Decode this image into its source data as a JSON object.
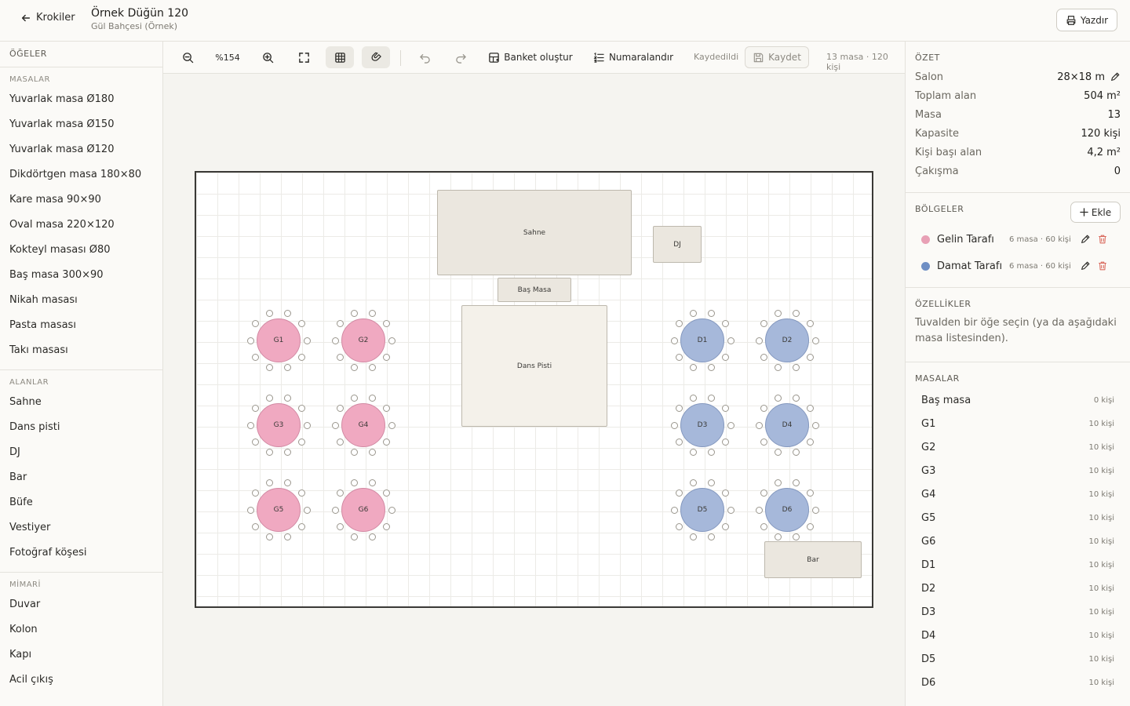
{
  "header": {
    "back_label": "Krokiler",
    "title": "Örnek Düğün 120",
    "subtitle": "Gül Bahçesi (Örnek)",
    "print_label": "Yazdır"
  },
  "sidebar": {
    "heading": "ÖĞELER",
    "sections": [
      {
        "title": "MASALAR",
        "items": [
          "Yuvarlak masa Ø180",
          "Yuvarlak masa Ø150",
          "Yuvarlak masa Ø120",
          "Dikdörtgen masa 180×80",
          "Kare masa 90×90",
          "Oval masa 220×120",
          "Kokteyl masası Ø80",
          "Baş masa 300×90",
          "Nikah masası",
          "Pasta masası",
          "Takı masası"
        ]
      },
      {
        "title": "ALANLAR",
        "items": [
          "Sahne",
          "Dans pisti",
          "DJ",
          "Bar",
          "Büfe",
          "Vestiyer",
          "Fotoğraf köşesi"
        ]
      },
      {
        "title": "MİMARİ",
        "items": [
          "Duvar",
          "Kolon",
          "Kapı",
          "Acil çıkış"
        ]
      }
    ]
  },
  "toolbar": {
    "zoom": "%154",
    "banquet_label": "Banket oluştur",
    "numbering_label": "Numaralandır",
    "saved_status": "Kaydedildi",
    "save_label": "Kaydet",
    "summary": "13 masa · 120 kişi"
  },
  "canvas": {
    "zones": {
      "stage": "Sahne",
      "dj": "DJ",
      "head_table": "Baş Masa",
      "dance": "Dans Pisti",
      "bar": "Bar"
    },
    "tables": [
      "G1",
      "G2",
      "G3",
      "G4",
      "G5",
      "G6",
      "D1",
      "D2",
      "D3",
      "D4",
      "D5",
      "D6"
    ]
  },
  "summary": {
    "heading": "ÖZET",
    "rows": [
      {
        "label": "Salon",
        "value": "28×18 m"
      },
      {
        "label": "Toplam alan",
        "value": "504 m²"
      },
      {
        "label": "Masa",
        "value": "13"
      },
      {
        "label": "Kapasite",
        "value": "120 kişi"
      },
      {
        "label": "Kişi başı alan",
        "value": "4,2 m²"
      },
      {
        "label": "Çakışma",
        "value": "0"
      }
    ]
  },
  "regions": {
    "heading": "BÖLGELER",
    "add_label": "Ekle",
    "items": [
      {
        "name": "Gelin Tarafı",
        "meta": "6 masa · 60 kişi",
        "color": "#e8a0b5"
      },
      {
        "name": "Damat Tarafı",
        "meta": "6 masa · 60 kişi",
        "color": "#6f8fc4"
      }
    ]
  },
  "properties": {
    "heading": "ÖZELLİKLER",
    "hint": "Tuvalden bir öğe seçin (ya da aşağıdaki masa listesinden)."
  },
  "tables_list": {
    "heading": "MASALAR",
    "items": [
      {
        "name": "Baş masa",
        "count": "0 kişi"
      },
      {
        "name": "G1",
        "count": "10 kişi"
      },
      {
        "name": "G2",
        "count": "10 kişi"
      },
      {
        "name": "G3",
        "count": "10 kişi"
      },
      {
        "name": "G4",
        "count": "10 kişi"
      },
      {
        "name": "G5",
        "count": "10 kişi"
      },
      {
        "name": "G6",
        "count": "10 kişi"
      },
      {
        "name": "D1",
        "count": "10 kişi"
      },
      {
        "name": "D2",
        "count": "10 kişi"
      },
      {
        "name": "D3",
        "count": "10 kişi"
      },
      {
        "name": "D4",
        "count": "10 kişi"
      },
      {
        "name": "D5",
        "count": "10 kişi"
      },
      {
        "name": "D6",
        "count": "10 kişi"
      }
    ]
  }
}
